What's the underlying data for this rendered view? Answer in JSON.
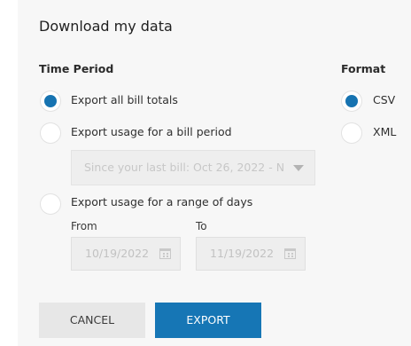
{
  "dialog": {
    "title": "Download my data"
  },
  "time_period": {
    "label": "Time Period",
    "options": [
      {
        "label": "Export all bill totals",
        "checked": true
      },
      {
        "label": "Export usage for a bill period",
        "checked": false
      },
      {
        "label": "Export usage for a range of days",
        "checked": false
      }
    ],
    "bill_period_select": {
      "value": "Since your last bill: Oct 26, 2022 - N"
    },
    "range": {
      "from_label": "From",
      "from_value": "10/19/2022",
      "to_label": "To",
      "to_value": "11/19/2022"
    }
  },
  "format": {
    "label": "Format",
    "options": [
      {
        "label": "CSV",
        "checked": true
      },
      {
        "label": "XML",
        "checked": false
      }
    ]
  },
  "buttons": {
    "cancel": "CANCEL",
    "export": "EXPORT"
  },
  "colors": {
    "accent": "#1673b1",
    "panel_bg": "#f7f7f7"
  }
}
